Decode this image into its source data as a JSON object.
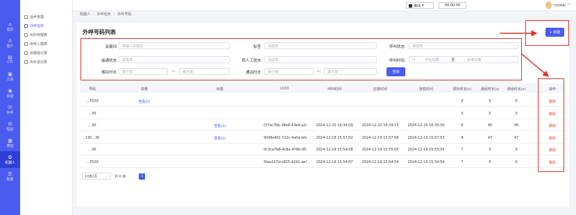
{
  "leftnav": [
    {
      "icon": "⌂",
      "label": "首页",
      "active": false
    },
    {
      "icon": "♙",
      "label": "客户",
      "active": false
    },
    {
      "icon": "▤",
      "label": "CTI",
      "active": false
    },
    {
      "icon": "▣",
      "label": "工单",
      "active": false
    },
    {
      "icon": "◉",
      "label": "会话",
      "active": false
    },
    {
      "icon": "☏",
      "label": "外呼",
      "active": false
    },
    {
      "icon": "✉",
      "label": "短信",
      "active": false
    },
    {
      "icon": "▦",
      "label": "质检",
      "active": false
    },
    {
      "icon": "⚙",
      "label": "机器人",
      "active": true
    },
    {
      "icon": "☰",
      "label": "配置",
      "active": false
    }
  ],
  "subnav": [
    {
      "label": "话术管理",
      "active": false
    },
    {
      "label": "外呼任务",
      "active": true
    },
    {
      "label": "AI外呼报表",
      "active": false
    },
    {
      "label": "AI呼入报表",
      "active": false
    },
    {
      "label": "AI通话记录",
      "active": false
    },
    {
      "label": "AI对话记录",
      "active": false
    }
  ],
  "topbar": {
    "status": "离线",
    "timer": "00:00:00",
    "username": "crystal"
  },
  "breadcrumb": [
    "机器人",
    "外呼任务",
    "外呼号码"
  ],
  "page": {
    "title": "外呼号码列表",
    "new_button": "+ 新建",
    "query_button": "查询"
  },
  "filters": {
    "keyword": {
      "label": "关键词",
      "placeholder": "请输入关键词"
    },
    "tag": {
      "label": "标签",
      "placeholder": "请选择"
    },
    "call_status": {
      "label": "呼叫状态",
      "placeholder": "请选择"
    },
    "connect_status": {
      "label": "接通状态",
      "placeholder": "请选择"
    },
    "transfer_status": {
      "label": "转人工状态",
      "placeholder": "请选择"
    },
    "call_time": {
      "label": "呼叫时间",
      "start": "开始日期",
      "to": "至",
      "end": "结束日期"
    },
    "ring_duration": {
      "label": "振铃时长",
      "min": "最小值",
      "max": "最大值"
    },
    "talk_duration": {
      "label": "通话时长",
      "min": "最小值",
      "max": "最大值"
    }
  },
  "table": {
    "headers": [
      "号码",
      "变量",
      "标签",
      "UUID",
      "呼叫时间",
      "应答时间",
      "挂机时间",
      "振铃时长(s)",
      "通话时长(s)",
      "通话时长(s)",
      "操作"
    ],
    "rows": [
      {
        "number": "...7520",
        "variable": "查看(1)",
        "tag": "",
        "uuid": "",
        "call": "",
        "answer": "",
        "hangup": "",
        "ring": "0",
        "talk": "0",
        "talk2": "0",
        "action": "删除"
      },
      {
        "number": "...30",
        "variable": "",
        "tag": "",
        "uuid": "",
        "call": "",
        "answer": "",
        "hangup": "",
        "ring": "0",
        "talk": "0",
        "talk2": "0",
        "action": "删除"
      },
      {
        "number": "...30",
        "variable": "",
        "tag": "查看(1)",
        "uuid": "f37ac7bb-38e8-43e4-a2a5...",
        "call": "2024-12-20 16:34:09",
        "answer": "2024-12-20 16:34:15",
        "hangup": "2024-12-20 16:35:00",
        "ring": "6",
        "talk": "45",
        "talk2": "45",
        "action": "删除"
      },
      {
        "number": "130...30",
        "variable": "",
        "tag": "查看(1)",
        "uuid": "9096e6f2-722c-4a0a-afe5...",
        "call": "2024-12-19 15:57:02",
        "answer": "2024-12-19 15:57:06",
        "hangup": "2024-12-19 15:57:53",
        "ring": "4",
        "talk": "47",
        "talk2": "47",
        "action": "删除"
      },
      {
        "number": "...30",
        "variable": "",
        "tag": "",
        "uuid": "0c3ca7b8-4c8a-478b-953...",
        "call": "2024-12-19 15:54:58",
        "answer": "2024-12-19 15:55:05",
        "hangup": "2024-12-19 15:55:05",
        "ring": "7",
        "talk": "0",
        "talk2": "0",
        "action": "删除"
      },
      {
        "number": "...7520",
        "variable": "",
        "tag": "",
        "uuid": "5fea167d-c825-4241-ae16...",
        "call": "2024-12-19 15:54:47",
        "answer": "2024-12-19 15:54:54",
        "hangup": "2024-12-19 15:54:54",
        "ring": "7",
        "talk": "0",
        "talk2": "0",
        "action": "删除"
      }
    ]
  },
  "pager": {
    "page_size": "10条/页",
    "total": "共 6 条",
    "current": "1"
  },
  "colors": {
    "accent": "#4a5bf0",
    "highlight": "#d9352c",
    "delete": "#e04b40"
  }
}
